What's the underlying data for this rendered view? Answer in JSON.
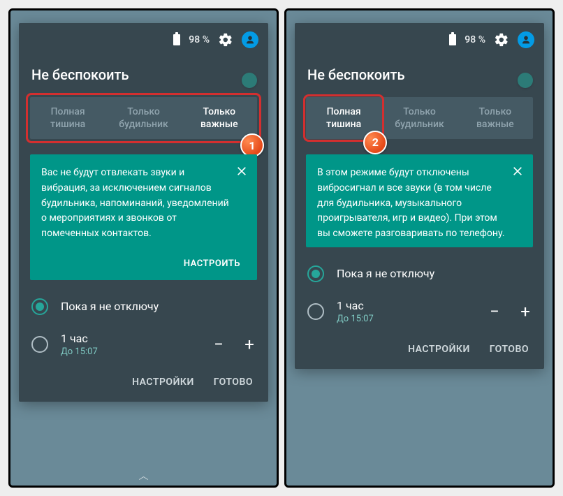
{
  "status": {
    "battery_text": "98 %"
  },
  "header": {
    "title": "Не беспокоить"
  },
  "tabs": {
    "t0": "Полная тишина",
    "t1": "Только будильник",
    "t2": "Только важные"
  },
  "left": {
    "active_tab": 2,
    "card_text": "Вас не будут отвлекать звуки и вибрация, за исключением сигналов будильника, напоминаний, уведомлений о мероприятиях и звонков от помеченных контактов.",
    "card_action": "НАСТРОИТЬ",
    "badge": "1"
  },
  "right": {
    "active_tab": 0,
    "card_text": "В этом режиме будут отключены вибросигнал и все звуки (в том числе для будильника, музыкального проигрывателя, игр и видео). При этом вы сможете разговаривать по телефону.",
    "badge": "2"
  },
  "radios": {
    "r0_label": "Пока я не отключу",
    "r1_label": "1 час",
    "r1_sub": "До 15:07"
  },
  "actions": {
    "settings": "НАСТРОЙКИ",
    "done": "ГОТОВО"
  }
}
